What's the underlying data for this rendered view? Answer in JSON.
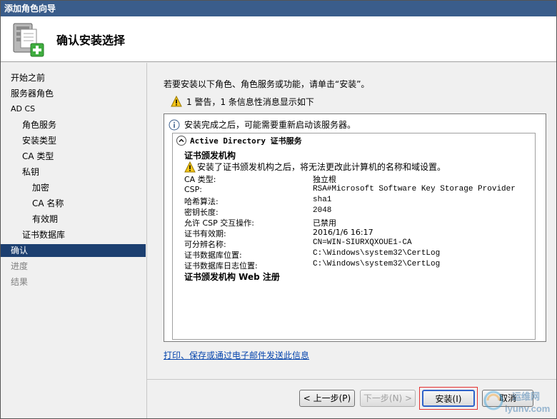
{
  "window": {
    "title": "添加角色向导",
    "heading": "确认安装选择"
  },
  "sidebar": {
    "items": [
      {
        "label": "开始之前",
        "state": "normal"
      },
      {
        "label": "服务器角色",
        "state": "normal"
      },
      {
        "label": "AD CS",
        "state": "normal"
      },
      {
        "label": "角色服务",
        "state": "normal"
      },
      {
        "label": "安装类型",
        "state": "normal"
      },
      {
        "label": "CA 类型",
        "state": "normal"
      },
      {
        "label": "私钥",
        "state": "normal"
      },
      {
        "label": "加密",
        "state": "normal"
      },
      {
        "label": "CA 名称",
        "state": "normal"
      },
      {
        "label": "有效期",
        "state": "normal"
      },
      {
        "label": "证书数据库",
        "state": "normal"
      },
      {
        "label": "确认",
        "state": "active"
      },
      {
        "label": "进度",
        "state": "disabled"
      },
      {
        "label": "结果",
        "state": "disabled"
      }
    ]
  },
  "main": {
    "intro": "若要安装以下角色、角色服务或功能，请单击“安装”。",
    "warning_summary": "1 警告，1 条信息性消息显示如下",
    "details": {
      "info_message": "安装完成之后，可能需要重新启动该服务器。",
      "section_title": "Active Directory 证书服务",
      "subsection_1": "证书颁发机构",
      "subsection_warning": "安装了证书颁发机构之后，将无法更改此计算机的名称和域设置。",
      "rows": [
        {
          "label": "CA 类型:",
          "value": "独立根"
        },
        {
          "label": "CSP:",
          "value": "RSA#Microsoft Software Key Storage Provider"
        },
        {
          "label": "哈希算法:",
          "value": "sha1"
        },
        {
          "label": "密钥长度:",
          "value": "2048"
        },
        {
          "label": "允许 CSP 交互操作:",
          "value": "已禁用"
        },
        {
          "label": "证书有效期:",
          "value": "2016/1/6 16:17"
        },
        {
          "label": "可分辨名称:",
          "value": "CN=WIN-SIURXQXOUE1-CA"
        },
        {
          "label": "证书数据库位置:",
          "value": "C:\\Windows\\system32\\CertLog"
        },
        {
          "label": "证书数据库日志位置:",
          "value": "C:\\Windows\\system32\\CertLog"
        }
      ],
      "subsection_2": "证书颁发机构 Web 注册"
    },
    "link": "打印、保存或通过电子邮件发送此信息"
  },
  "buttons": {
    "previous": "< 上一步(P)",
    "next": "下一步(N) >",
    "install": "安装(I)",
    "cancel": "取消"
  },
  "watermark": {
    "text_1": "运维网",
    "text_2": "iyunv.com"
  },
  "colors": {
    "titlebar": "#3a5d8b",
    "active_nav": "#1c3f70",
    "link": "#0645ad",
    "highlight_border": "#e53030"
  }
}
